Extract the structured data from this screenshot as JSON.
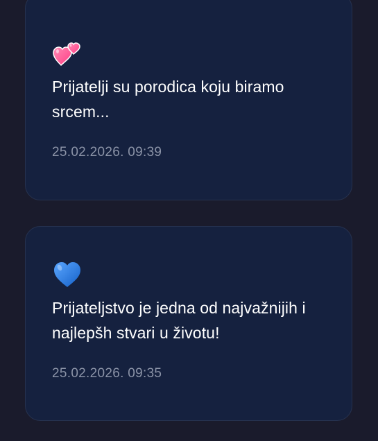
{
  "posts": [
    {
      "emoji": "two-hearts-icon",
      "text": "Prijatelji su porodica koju biramo srcem...",
      "timestamp": "25.02.2026. 09:39",
      "colors": {
        "heart_primary": "#ff4d8d",
        "heart_secondary": "#ff8ab5"
      }
    },
    {
      "emoji": "blue-heart-icon",
      "text": "Prijateljstvo je jedna od najvažnijih i najlepšh stvari u životu!",
      "timestamp": "25.02.2026. 09:35",
      "colors": {
        "heart_primary": "#1e78e0",
        "heart_secondary": "#5aa6ff"
      }
    }
  ],
  "theme": {
    "background": "#1a1b2c",
    "card_background": "#15213f",
    "card_border": "#26324f",
    "text_color": "#ffffff",
    "timestamp_color": "#8b93a7"
  }
}
